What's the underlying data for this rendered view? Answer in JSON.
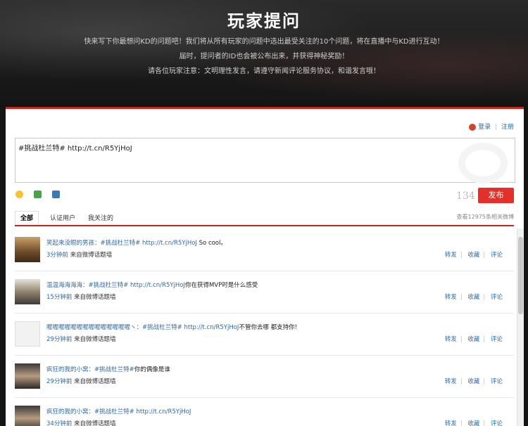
{
  "hero": {
    "title": "玩家提问",
    "lines": [
      "快来写下你最想问KD的问题吧！我们将从所有玩家的问题中选出最受关注的10个问题，将在直播中与KD进行互动！",
      "届时，提问者的ID也会被公布出来，并获得神秘奖励！",
      "请各位玩家注意：文明理性发言，请遵守新闻评论服务协议，和谐发言哦！"
    ]
  },
  "login": {
    "login_label": "登录",
    "sep": "|",
    "register_label": "注册"
  },
  "compose": {
    "text": "#挑战杜兰特# http://t.cn/R5YjHoJ",
    "counter": "134",
    "publish_label": "发布"
  },
  "toolbar": {
    "icons": [
      "emoji-icon",
      "image-icon",
      "topic-icon"
    ]
  },
  "tabs": {
    "items": [
      "全部",
      "认证用户",
      "我关注的"
    ],
    "count_text": "查看12975条相关微博"
  },
  "feed": [
    {
      "user": "笑起来没眼的男孩：",
      "tag": "#挑战杜兰特#",
      "url": "http://t.cn/R5YjHoJ",
      "text": "So cool。",
      "time": "3分钟前",
      "source": "来自微博话题墙",
      "actions": [
        "转发",
        "收藏",
        "评论"
      ]
    },
    {
      "user": "温温海海海海：",
      "tag": "#挑战杜兰特#",
      "url": "http://t.cn/R5YjHoJ",
      "text": "你在获得MVP时是什么感受",
      "time": "15分钟前",
      "source": "来自微博话题墙",
      "actions": [
        "转发",
        "收藏",
        "评论"
      ]
    },
    {
      "user": "喔喔喔喔喔喔喔喔喔喔喔喔喔喔ヽ：",
      "tag": "#挑战杜兰特#",
      "url": "http://t.cn/R5YjHoJ",
      "text": "不管你去哪 都支持你!",
      "time": "29分钟前",
      "source": "来自微博话题墙",
      "actions": [
        "转发",
        "收藏",
        "评论"
      ]
    },
    {
      "user": "疯狂的我的小窝：",
      "tag": "#挑战杜兰特#",
      "url": "",
      "text": "你的偶像是谁",
      "time": "29分钟前",
      "source": "来自微博话题墙",
      "actions": [
        "转发",
        "收藏",
        "评论"
      ]
    },
    {
      "user": "疯狂的我的小窝：",
      "tag": "#挑战杜兰特#",
      "url": "http://t.cn/R5YjHoJ",
      "text": "",
      "time": "34分钟前",
      "source": "来自微博话题墙",
      "actions": [
        "转发",
        "收藏",
        "评论"
      ]
    }
  ]
}
